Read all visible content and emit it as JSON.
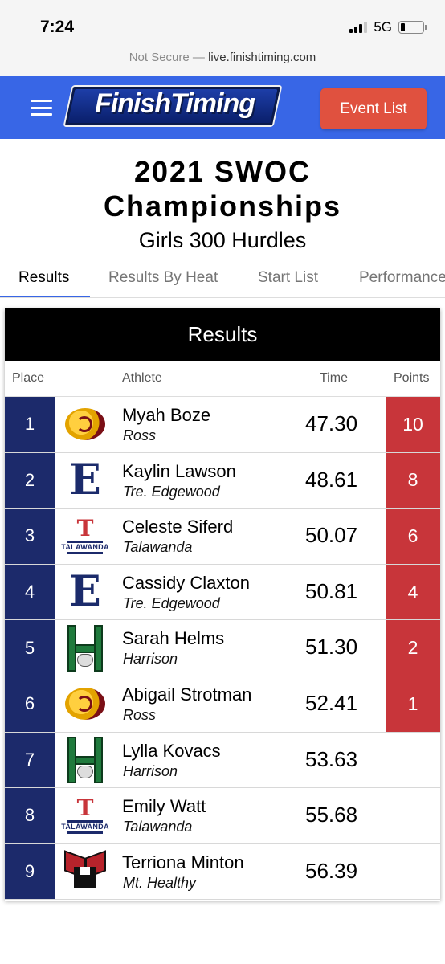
{
  "status_bar": {
    "time": "7:24",
    "network": "5G",
    "signal_bars_active": 3,
    "signal_bars_total": 4,
    "battery_level": 0.2
  },
  "url_bar": {
    "not_secure": "Not Secure",
    "separator": "—",
    "domain": "live.finishtiming.com"
  },
  "header": {
    "logo_text": "FinishTiming",
    "event_list_label": "Event List",
    "colors": {
      "header_bg": "#3866e6",
      "button_bg": "#e0513f"
    }
  },
  "page": {
    "title_line1": "2021 SWOC",
    "title_line2": "Championships",
    "subtitle": "Girls 300 Hurdles"
  },
  "tabs": [
    {
      "label": "Results",
      "active": true
    },
    {
      "label": "Results By Heat",
      "active": false
    },
    {
      "label": "Start List",
      "active": false
    },
    {
      "label": "Performance",
      "active": false
    }
  ],
  "results": {
    "heading": "Results",
    "columns": {
      "place": "Place",
      "athlete": "Athlete",
      "time": "Time",
      "points": "Points"
    },
    "rows": [
      {
        "place": "1",
        "name": "Myah Boze",
        "team": "Ross",
        "time": "47.30",
        "points": "10",
        "logo": "ross-ram-icon"
      },
      {
        "place": "2",
        "name": "Kaylin Lawson",
        "team": "Tre. Edgewood",
        "time": "48.61",
        "points": "8",
        "logo": "edgewood-e-icon"
      },
      {
        "place": "3",
        "name": "Celeste Siferd",
        "team": "Talawanda",
        "time": "50.07",
        "points": "6",
        "logo": "talawanda-t-icon"
      },
      {
        "place": "4",
        "name": "Cassidy Claxton",
        "team": "Tre. Edgewood",
        "time": "50.81",
        "points": "4",
        "logo": "edgewood-e-icon"
      },
      {
        "place": "5",
        "name": "Sarah Helms",
        "team": "Harrison",
        "time": "51.30",
        "points": "2",
        "logo": "harrison-h-icon"
      },
      {
        "place": "6",
        "name": "Abigail Strotman",
        "team": "Ross",
        "time": "52.41",
        "points": "1",
        "logo": "ross-ram-icon"
      },
      {
        "place": "7",
        "name": "Lylla Kovacs",
        "team": "Harrison",
        "time": "53.63",
        "points": "",
        "logo": "harrison-h-icon"
      },
      {
        "place": "8",
        "name": "Emily Watt",
        "team": "Talawanda",
        "time": "55.68",
        "points": "",
        "logo": "talawanda-t-icon"
      },
      {
        "place": "9",
        "name": "Terriona Minton",
        "team": "Mt. Healthy",
        "time": "56.39",
        "points": "",
        "logo": "mt-healthy-mh-icon"
      }
    ],
    "colors": {
      "place_bg": "#1c2a6b",
      "points_bg": "#c8353a"
    }
  }
}
